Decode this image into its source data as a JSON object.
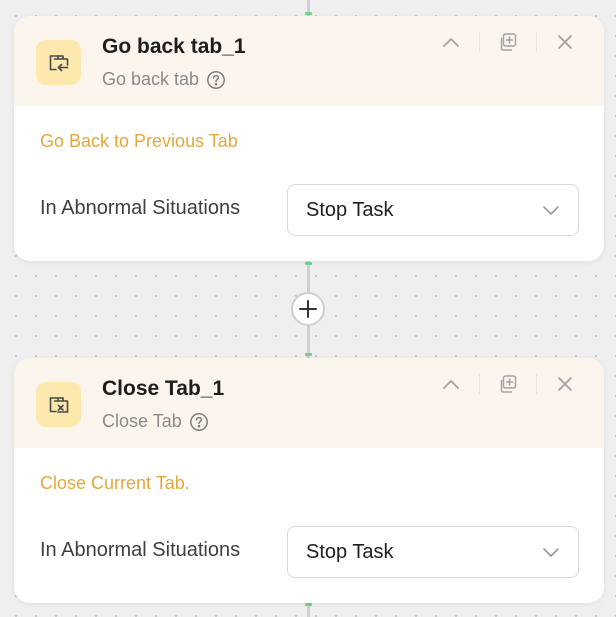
{
  "cards": [
    {
      "icon": "tab-back-icon",
      "title": "Go back tab_1",
      "subtitle": "Go back tab",
      "description": "Go Back to Previous Tab",
      "field_label": "In Abnormal Situations",
      "field_value": "Stop Task"
    },
    {
      "icon": "tab-close-icon",
      "title": "Close Tab_1",
      "subtitle": "Close Tab",
      "description": "Close Current Tab.",
      "field_label": "In Abnormal Situations",
      "field_value": "Stop Task"
    }
  ],
  "colors": {
    "canvas": "#efefef",
    "card_header": "#fcf5ee",
    "icon_tile": "#fde8ad",
    "description": "#e5a73a",
    "connector": "#cfcfcf",
    "connector_tip": "#6fd38a"
  }
}
